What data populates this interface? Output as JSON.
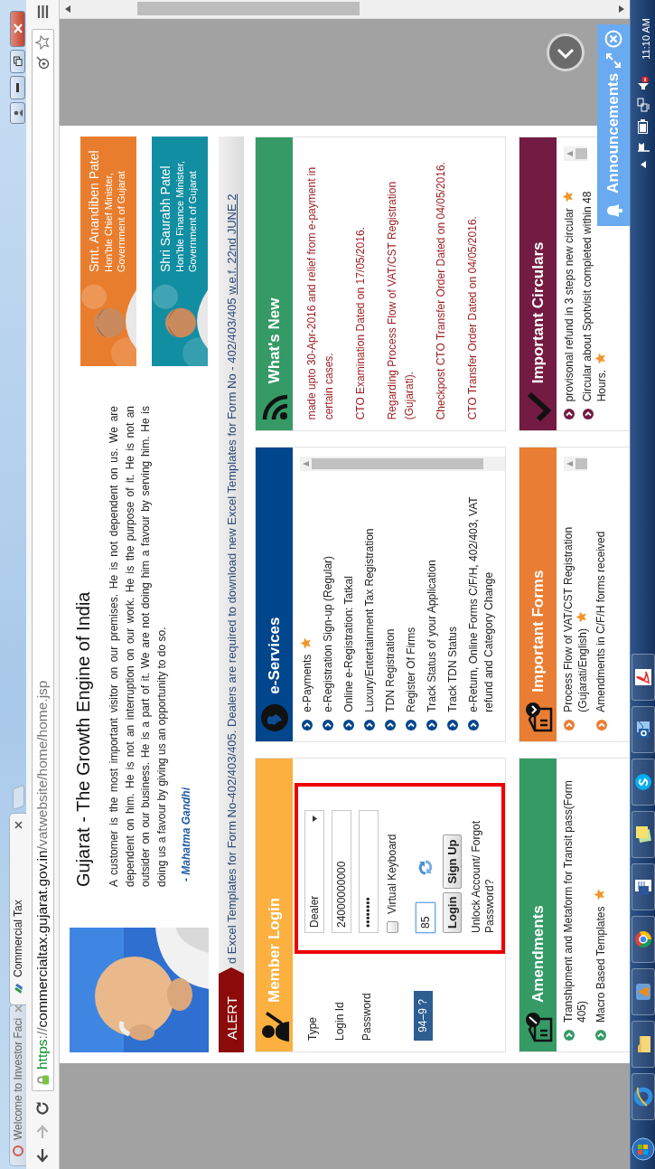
{
  "browser": {
    "tabs": [
      {
        "title": "Welcome to Investor Faci",
        "selected": false
      },
      {
        "title": "Commercial Tax",
        "selected": true
      }
    ],
    "url": "https://commercialtax.gujarat.gov.in/vatwebsite/home/home.jsp"
  },
  "header": {
    "title": "Gujarat - The Growth Engine of India",
    "quote": "A customer is the most important visitor on our premises. He is not dependent on us. We are dependent on him. He is not an interruption on our work. He is the purpose of it. He is not an outsider on our business. He is a part of it. We are not doing him a favour by serving him. He is doing us a favour by giving us an opportunity to do so.",
    "author": "- Mahatma Gandhi",
    "leaders": [
      {
        "name": "Smt. Anandiben Patel",
        "role": "Hon'ble Chief Minister,",
        "org": "Government of Gujarat",
        "color": "#e97d2e"
      },
      {
        "name": "Shri Saurabh Patel",
        "role": "Hon'ble Finance Minister,",
        "org": "Government of Gujarat",
        "color": "#128ea2"
      }
    ]
  },
  "alert": {
    "label": "ALERT",
    "text": "d Excel Templates for Form No-402/403/405. Dealers are required to download new Excel Templates for Form No - 402/403/405 ",
    "link": "w.e.f. 22nd JUNE 2"
  },
  "panels": [
    {
      "kind": "login",
      "title": "Member Login",
      "color": "#fbb040",
      "fields": [
        {
          "label": "Type",
          "kind": "select",
          "value": "Dealer"
        },
        {
          "label": "Login Id",
          "kind": "text",
          "value": "24000000000"
        },
        {
          "label": "Password",
          "kind": "password",
          "value": "••••••••"
        }
      ],
      "virtual_keyboard": {
        "label": "Virtual Keyboard",
        "checked": false
      },
      "captcha": {
        "question": "94–9 ?",
        "answer": "85"
      },
      "buttons": [
        "Login",
        "Sign Up"
      ],
      "help": "Unlock Account/ Forgot Password?"
    },
    {
      "kind": "links",
      "title": "e-Services",
      "color": "#00468c",
      "scrollable": true,
      "items": [
        {
          "text": "e-Payments",
          "new": true
        },
        {
          "text": "e-Registration Sign-up (Regular)",
          "new": false
        },
        {
          "text": "Online e-Registration: Tatkal",
          "new": false
        },
        {
          "text": "Luxury/Entertainment Tax Registration",
          "new": false
        },
        {
          "text": "TDN Registration",
          "new": false
        },
        {
          "text": "Register Of Firms",
          "new": false
        },
        {
          "text": "Track Status of your Application",
          "new": false
        },
        {
          "text": "Track TDN Status",
          "new": false
        },
        {
          "text": "e-Return, Online Forms C/F/H, 402/403, VAT refund and Category Change",
          "new": false
        }
      ]
    },
    {
      "kind": "news",
      "title": "What's New",
      "color": "#359a65",
      "scrollable": false,
      "items": [
        "made upto 30-Apr-2016 and relief from e-payment in certain cases.",
        "CTO Examination Dated on 17/05/2016.",
        "Regarding Process Flow of VAT/CST Registration (Gujarati).",
        "Checkpost CTO Transfer Order Dated on 04/05/2016.",
        "CTO Transfer Order Dated on 04/05/2016."
      ]
    },
    {
      "kind": "links",
      "title": "Amendments",
      "color": "#359a65",
      "scrollable": false,
      "items": [
        {
          "text": "Transhipment and Metaform for Transit pass(Form 405)",
          "new": false
        },
        {
          "text": "Macro Based Templates",
          "new": true
        }
      ]
    },
    {
      "kind": "links",
      "title": "Important Forms",
      "color": "#e97d33",
      "scrollable": true,
      "items": [
        {
          "text": "Process Flow of VAT/CST Registration (Gujarati/English)",
          "new": true
        },
        {
          "text": "Amendments in C/F/H forms received",
          "new": false
        }
      ]
    },
    {
      "kind": "links",
      "title": "Important Circulars",
      "color": "#731b42",
      "scrollable": true,
      "items": [
        {
          "text": "provisonal refund in 3 steps new circular",
          "new": true
        },
        {
          "text": "Circular about Spotvisit completed within 48 Hours.",
          "new": true
        }
      ]
    }
  ],
  "announcements": {
    "title": "Announcements"
  },
  "taskbar": {
    "time": "11:10 AM"
  }
}
